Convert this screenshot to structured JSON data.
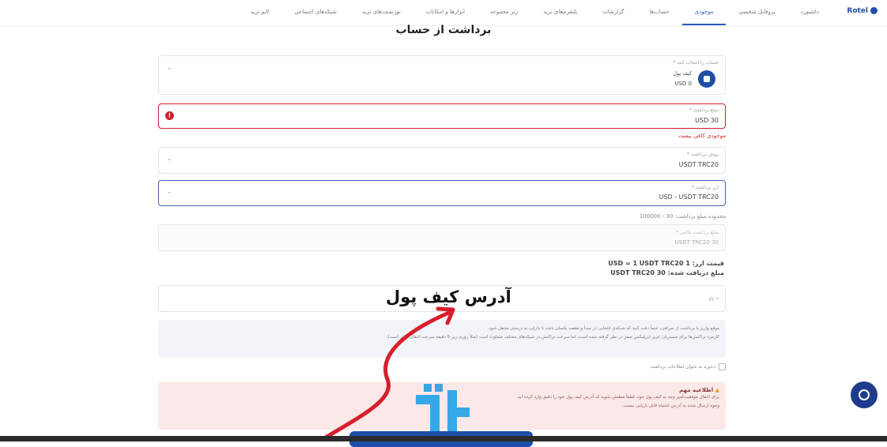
{
  "nav": {
    "logo": "Rotel",
    "items": [
      "داشبورد",
      "پروفایل شخصی",
      "موجودی",
      "حساب‌ها",
      "گزارشات",
      "پلتفرم‌های ترید",
      "ربز مجموعه",
      "ابزارها و امکانات",
      "تورنمنت‌های ترید",
      "شبکه‌های اجتماعی",
      "لایو ترید"
    ],
    "active_index": 2
  },
  "page_title": "برداشت از حساب",
  "account": {
    "label": "حساب را انتخاب کنید *",
    "name": "کیف پول",
    "balance": "USD 0"
  },
  "amount": {
    "label": "مبلغ برداشت *",
    "value": "30 USD",
    "error": "موجودی کافی نیست"
  },
  "method": {
    "label": "روش برداشت *",
    "value": "USDT TRC20"
  },
  "currency": {
    "label": "ارز برداشت *",
    "value": "USD - USDT TRC20"
  },
  "range_note": "محدوده مبلغ برداشت: 30 - 100000",
  "net": {
    "label": "مبلغ برداشت خالص *",
    "value": "30 USDT TRC20"
  },
  "rate": {
    "price": "قیمت ارز: 1 USD = 1 USDT TRC20",
    "received": "مبلغ دریافت شده: 30 USDT TRC20"
  },
  "wallet_address": {
    "placeholder": "* W"
  },
  "annotation": "آدرس کیف پول",
  "info": {
    "line1": "موقع واریز یا برداشت از صرافی، حتماً دقت کنید که شبکه‌ی انتخابی در مبدأ و مقصد یکسان باشد تا دارایی به درستی منتقل شود.",
    "line2": "کارمزد تراکنش‌ها برای مشتریان عزیز ایرپلیکس صفر در نظر گرفته شده است، اما سرعت تراکنش در شبکه‌های مختلف متفاوت است (مثلاً زوری زیر 5 دقیقه سرعت انتقال بالاتر است)."
  },
  "save_checkbox_label": "ذخیره به عنوان اطلاعات برداشت",
  "warning": {
    "title": "اطلاعیه مهم",
    "line1": "برای انتقال موفقیت‌آمیز وجه به کیف پول خود، لطفاً مطمئن شوید که آدرس کیف پول خود را دقیق وارد کرده اید.",
    "line2": "وجوه ارسال شده به آدرس اشتباه قابل بازیابی نیست."
  },
  "colors": {
    "accent": "#1e4fa8",
    "error": "#d11f2a",
    "arrow": "#d81e2c",
    "watermark": "#36a8e8"
  },
  "icons": [
    "wallet-icon",
    "error-icon",
    "chevron-down-icon",
    "warning-icon",
    "chat-icon"
  ]
}
